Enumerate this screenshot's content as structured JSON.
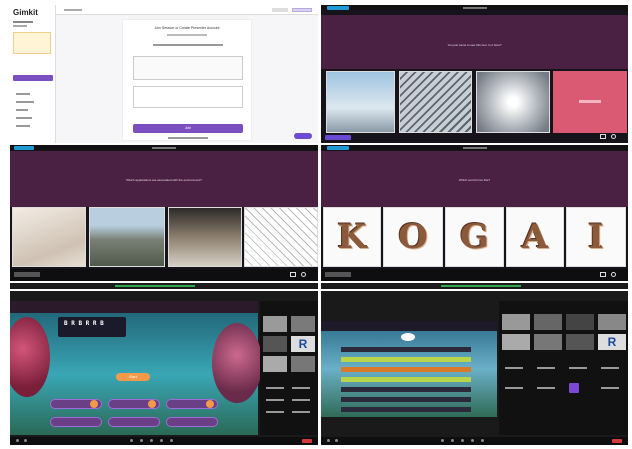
{
  "login": {
    "logo": "Gimkit",
    "prompt": "Join Session or Create Presenter Account",
    "join_label": "Join",
    "join_button": "Join"
  },
  "slides": {
    "top_right_question": "You just came to see this tour. Is it here?",
    "mid_left_question": "Which applications are associated with the environment?",
    "mid_right_question": "Which word forms this?"
  },
  "koga_letters": [
    "K",
    "O",
    "G",
    "A",
    "I"
  ],
  "game": {
    "code": "B R B R R B",
    "start_label": "Start"
  },
  "video": {
    "badge": "R"
  },
  "colors": {
    "accent": "#4a2142",
    "pink": "#d95a72",
    "purple_button": "#6a3f86",
    "orange": "#f39a4a",
    "green": "#2ea84e"
  }
}
